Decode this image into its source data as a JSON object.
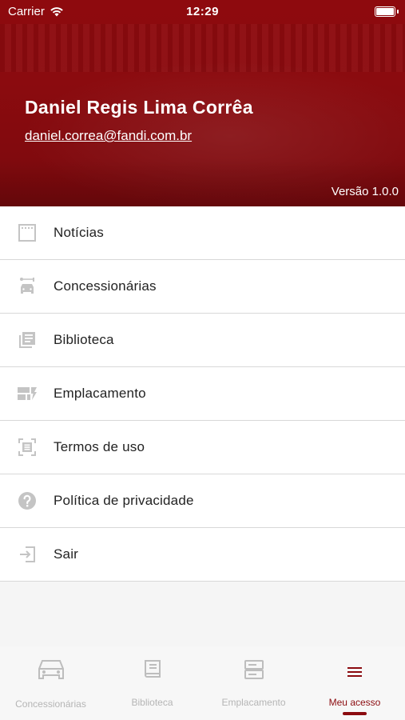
{
  "status_bar": {
    "carrier": "Carrier",
    "time": "12:29"
  },
  "profile": {
    "name": "Daniel Regis Lima Corrêa",
    "email": "daniel.correa@fandi.com.br",
    "version": "Versão 1.0.0"
  },
  "menu": {
    "items": [
      {
        "label": "Notícias",
        "icon": "news-icon"
      },
      {
        "label": "Concessionárias",
        "icon": "dealership-icon"
      },
      {
        "label": "Biblioteca",
        "icon": "library-icon"
      },
      {
        "label": "Emplacamento",
        "icon": "plate-icon"
      },
      {
        "label": "Termos de uso",
        "icon": "terms-icon"
      },
      {
        "label": "Política de privacidade",
        "icon": "help-icon"
      },
      {
        "label": "Sair",
        "icon": "logout-icon"
      }
    ]
  },
  "tabbar": {
    "tabs": [
      {
        "label": "Concessionárias",
        "icon": "car-icon"
      },
      {
        "label": "Biblioteca",
        "icon": "book-icon"
      },
      {
        "label": "Emplacamento",
        "icon": "server-icon"
      },
      {
        "label": "Meu acesso",
        "icon": "menu-icon",
        "active": true
      }
    ]
  },
  "colors": {
    "brand": "#8b0b0f",
    "icon_gray": "#c4c4c4",
    "inactive_tab": "#b5b5b5"
  }
}
